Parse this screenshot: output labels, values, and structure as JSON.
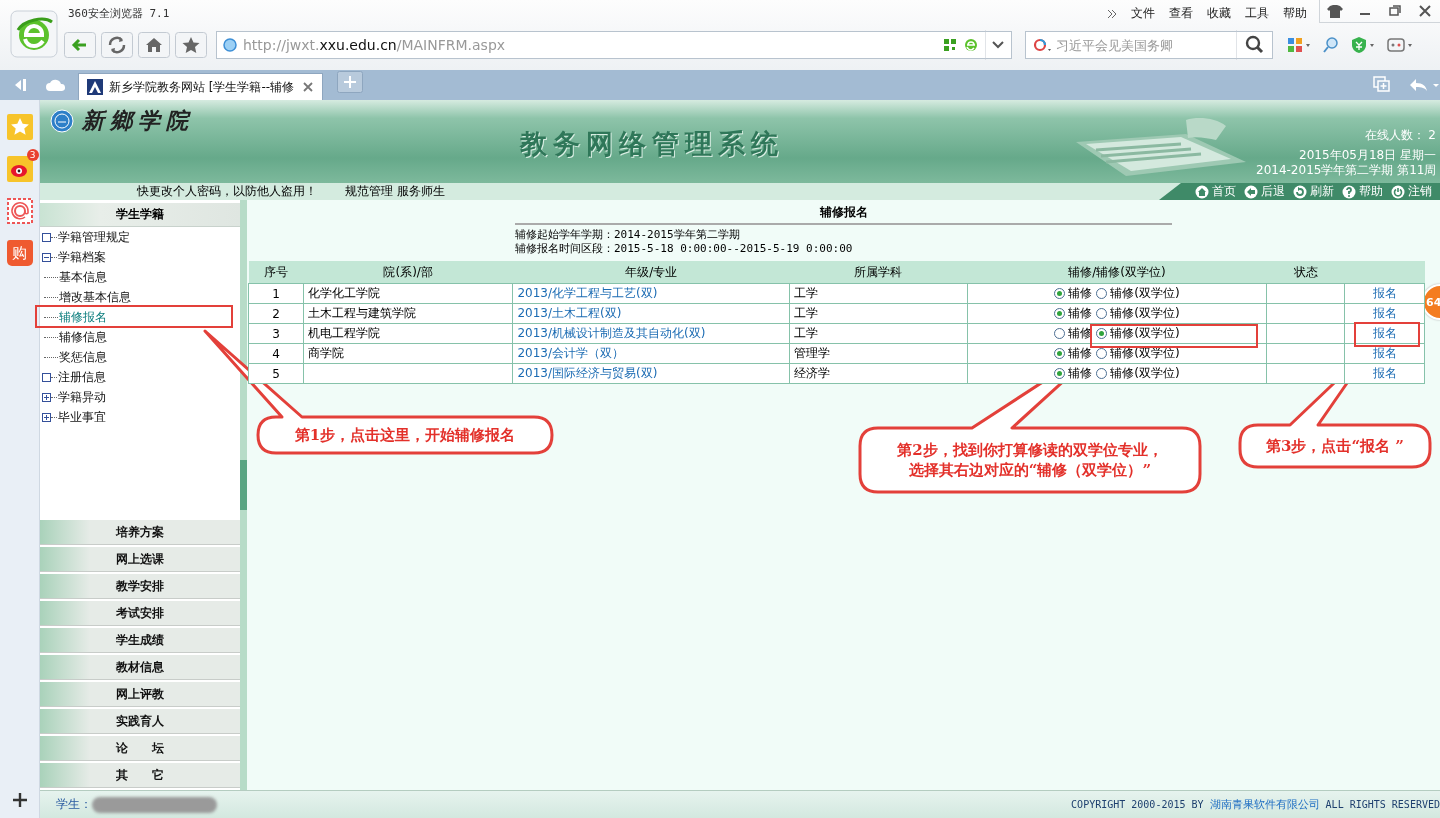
{
  "browser": {
    "title": "360安全浏览器 7.1",
    "menu": [
      "文件",
      "查看",
      "收藏",
      "工具",
      "帮助"
    ],
    "url_parts": [
      {
        "text": "http://jwxt.",
        "kind": "dim"
      },
      {
        "text": "xxu.edu.cn",
        "kind": "host"
      },
      {
        "text": "/MAINFRM.aspx",
        "kind": "dim"
      }
    ],
    "search": {
      "placeholder": "习近平会见美国务卿"
    },
    "tabs": [
      {
        "label": "新乡学院教务网站 [学生学籍--辅修",
        "selected": true
      }
    ]
  },
  "app_bar": [
    {
      "kind": "star"
    },
    {
      "kind": "weibo",
      "badge": "3"
    },
    {
      "kind": "mail"
    },
    {
      "kind": "shop",
      "label": "购"
    }
  ],
  "header": {
    "school_name": "新鄉学院",
    "system_title": "教务网络管理系统",
    "online": "在线人数： 2",
    "date": "2015年05月18日 星期一",
    "term": "2014-2015学年第二学期 第11周",
    "notice": "快更改个人密码，以防他人盗用！",
    "slogan": "规范管理 服务师生",
    "nav": [
      {
        "kind": "home",
        "label": "首页"
      },
      {
        "kind": "back",
        "label": "后退"
      },
      {
        "kind": "refresh",
        "label": "刷新"
      },
      {
        "kind": "help",
        "label": "帮助"
      },
      {
        "kind": "logout",
        "label": "注销"
      }
    ]
  },
  "sidebar": {
    "title": "学生学籍",
    "items": [
      {
        "label": "学籍管理规定",
        "kind": "page"
      },
      {
        "label": "学籍档案",
        "kind": "folder",
        "expanded": true,
        "children": [
          {
            "label": "基本信息",
            "selected": false
          },
          {
            "label": "增改基本信息",
            "selected": false
          },
          {
            "label": "辅修报名",
            "selected": true
          },
          {
            "label": "辅修信息",
            "selected": false
          },
          {
            "label": "奖惩信息",
            "selected": false
          }
        ]
      },
      {
        "label": "注册信息",
        "kind": "page"
      },
      {
        "label": "学籍异动",
        "kind": "folder",
        "expanded": false
      },
      {
        "label": "毕业事宜",
        "kind": "folder",
        "expanded": false
      }
    ],
    "sections": [
      "培养方案",
      "网上选课",
      "教学安排",
      "考试安排",
      "学生成绩",
      "教材信息",
      "网上评教",
      "实践育人",
      "论　　坛",
      "其　　它"
    ]
  },
  "content": {
    "title": "辅修报名",
    "info": [
      "辅修起始学年学期：2014-2015学年第二学期",
      "辅修报名时间区段：2015-5-18 0:00:00--2015-5-19 0:00:00"
    ],
    "table": {
      "columns": [
        "序号",
        "院(系)/部",
        "年级/专业",
        "所属学科",
        "辅修/辅修(双学位)",
        "状态"
      ],
      "rows": [
        {
          "no": "1",
          "department": "化学化工学院",
          "major": "2013/化学工程与工艺(双)",
          "discipline": "工学",
          "options": [
            {
              "label": "辅修",
              "selected": true
            },
            {
              "label": "辅修(双学位)",
              "selected": false
            }
          ],
          "action": "报名"
        },
        {
          "no": "2",
          "department": "土木工程与建筑学院",
          "major": "2013/土木工程(双)",
          "discipline": "工学",
          "options": [
            {
              "label": "辅修",
              "selected": true
            },
            {
              "label": "辅修(双学位)",
              "selected": false
            }
          ],
          "action": "报名"
        },
        {
          "no": "3",
          "department": "机电工程学院",
          "major": "2013/机械设计制造及其自动化(双)",
          "discipline": "工学",
          "options": [
            {
              "label": "辅修",
              "selected": false
            },
            {
              "label": "辅修(双学位)",
              "selected": true
            }
          ],
          "action": "报名"
        },
        {
          "no": "4",
          "department": "商学院",
          "major": "2013/会计学（双）",
          "discipline": "管理学",
          "options": [
            {
              "label": "辅修",
              "selected": true
            },
            {
              "label": "辅修(双学位)",
              "selected": false
            }
          ],
          "action": "报名"
        },
        {
          "no": "5",
          "major": "2013/国际经济与贸易(双)",
          "discipline": "经济学",
          "options": [
            {
              "label": "辅修",
              "selected": true
            },
            {
              "label": "辅修(双学位)",
              "selected": false
            }
          ],
          "action": "报名"
        }
      ]
    }
  },
  "annotations": [
    {
      "lines": [
        "第1步，点击这里，开始辅修报名"
      ]
    },
    {
      "lines": [
        "第2步，找到你打算修读的双学位专业，",
        "选择其右边对应的“辅修（双学位）”"
      ]
    },
    {
      "lines": [
        "第3步，点击“报名 ”"
      ]
    }
  ],
  "floating_badge": "64",
  "status_bar": {
    "student_label": "学生：",
    "copyright": [
      {
        "text": "COPYRIGHT 2000-2015 BY ",
        "kind": "plain"
      },
      {
        "text": "湖南青果软件有限公司",
        "kind": "link"
      },
      {
        "text": " ALL RIGHTS RESERVED",
        "kind": "plain"
      }
    ]
  }
}
